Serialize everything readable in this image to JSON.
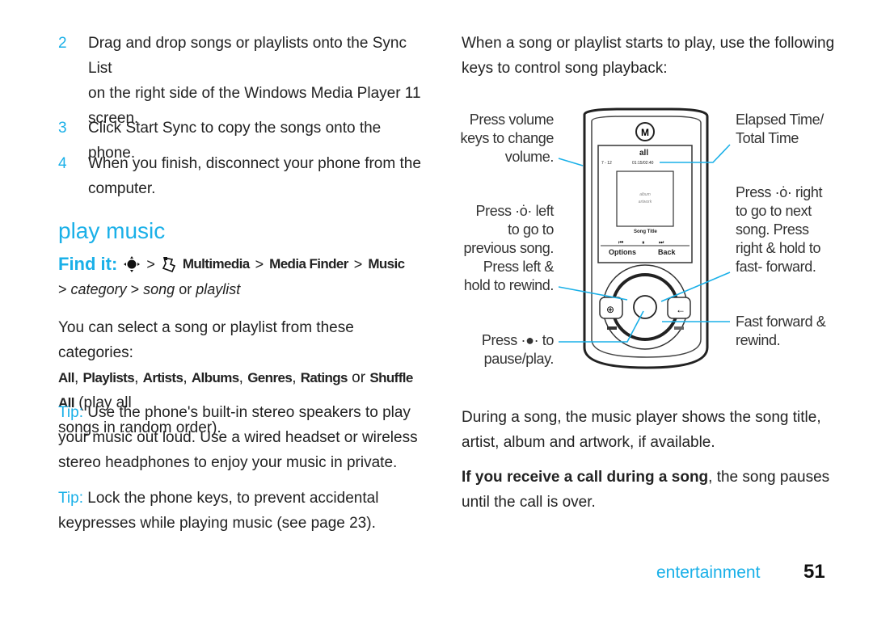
{
  "left": {
    "steps": [
      {
        "num": "2",
        "lines": [
          "Drag and drop songs or playlists onto the Sync List",
          "on the right side of the Windows Media Player 11",
          "screen."
        ]
      },
      {
        "num": "3",
        "lines": [
          "Click Start Sync to copy the songs onto the phone."
        ]
      },
      {
        "num": "4",
        "lines": [
          "When you finish, disconnect your phone from the",
          "computer."
        ]
      }
    ],
    "heading": "play music",
    "find_it": {
      "label": "Find it:",
      "sep": ">",
      "items": [
        "Multimedia",
        "Media Finder",
        "Music"
      ],
      "line2": {
        "category": "category",
        "song": "song",
        "or": "or",
        "playlist": "playlist"
      }
    },
    "categories_intro": "You can select a song or playlist from these categories:",
    "categories": [
      "All",
      "Playlists",
      "Artists",
      "Albums",
      "Genres",
      "Ratings"
    ],
    "categories_or": "or",
    "shuffle": "Shuffle All",
    "shuffle_desc_1": "(play all",
    "shuffle_desc_2": "songs in random order).",
    "tip1": {
      "label": "Tip:",
      "lines": [
        "Use the phone's built-in stereo speakers to play",
        "your music out loud. Use a wired headset or wireless",
        "stereo headphones to enjoy your music in private."
      ]
    },
    "tip2": {
      "label": "Tip:",
      "lines": [
        "Lock the phone keys, to prevent accidental",
        "keypresses while playing music (see page 23)."
      ]
    }
  },
  "right": {
    "intro": [
      "When a song or playlist starts to play, use the following",
      "keys to control song playback:"
    ],
    "callouts": {
      "volume": [
        "Press volume",
        "keys to change",
        "volume."
      ],
      "left": [
        "left",
        "to go to",
        "previous song.",
        "Press left &",
        "hold to rewind."
      ],
      "left_press": "Press",
      "center_press": "Press",
      "center_to": "to",
      "center_2": "pause/play.",
      "elapsed": [
        "Elapsed Time/",
        "Total Time"
      ],
      "right_press": "Press",
      "right": [
        "right",
        "to go to next",
        "song. Press",
        "right & hold to",
        "fast- forward."
      ],
      "ff": [
        "Fast forward &",
        "rewind."
      ]
    },
    "phone_screen": {
      "mode": "all",
      "track": "7 - 12",
      "time": "01:15/02:40",
      "art": [
        "album",
        "artwork"
      ],
      "song_title": "Song Title",
      "soft_left": "Options",
      "soft_right": "Back"
    },
    "after": [
      "During a song, the music player shows the song title,",
      "artist, album and artwork, if available."
    ],
    "call_bold": "If you receive a call during a song",
    "call_rest": ", the song pauses",
    "call_line2": "until the call is over."
  },
  "footer": {
    "section": "entertainment",
    "page": "51"
  },
  "colors": {
    "accent": "#1ab0e8",
    "text": "#222222"
  },
  "icons": [
    "nav-key-icon",
    "multimedia-icon",
    "globe-icon",
    "back-arrow-icon"
  ]
}
